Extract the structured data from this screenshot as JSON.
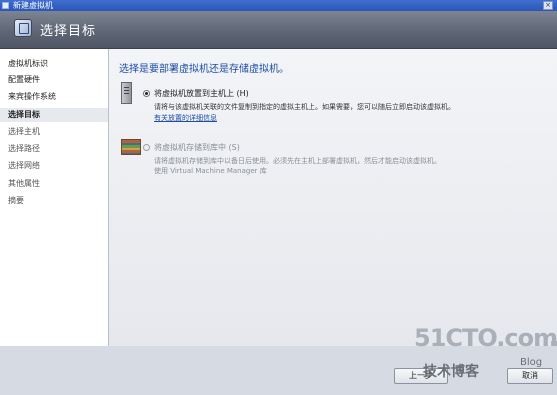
{
  "window": {
    "title": "新建虚拟机",
    "close_glyph": "×"
  },
  "banner": {
    "title": "选择目标",
    "icon": "wizard-page-icon"
  },
  "sidebar": {
    "items": [
      {
        "label": "虚拟机标识",
        "state": "normal"
      },
      {
        "label": "配置硬件",
        "state": "normal"
      },
      {
        "label": "来宾操作系统",
        "state": "normal"
      },
      {
        "label": "选择目标",
        "state": "active"
      },
      {
        "label": "选择主机",
        "state": "dim"
      },
      {
        "label": "选择路径",
        "state": "dim"
      },
      {
        "label": "选择网络",
        "state": "dim"
      },
      {
        "label": "其他属性",
        "state": "dim"
      },
      {
        "label": "摘要",
        "state": "dim"
      }
    ]
  },
  "main": {
    "heading": "选择是要部署虚拟机还是存储虚拟机。",
    "options": [
      {
        "label": "将虚拟机放置到主机上 (H)",
        "description": "请将与该虚拟机关联的文件复制到指定的虚拟主机上。如果需要，您可以随后立即启动该虚拟机。",
        "link": "有关放置的详细信息",
        "selected": true,
        "enabled": true,
        "icon": "server-icon"
      },
      {
        "label": "将虚拟机存储到库中 (S)",
        "description": "请将虚拟机存储到库中以备日后使用。必须先在主机上部署虚拟机，然后才能启动该虚拟机。",
        "description2": "使用 Virtual Machine Manager 库",
        "selected": false,
        "enabled": false,
        "icon": "library-icon"
      }
    ]
  },
  "footer": {
    "prev_label": "上一步",
    "cancel_label": "取消"
  },
  "watermark": {
    "domain": "51CTO.com",
    "sub": "技术博客",
    "blog": "Blog"
  }
}
